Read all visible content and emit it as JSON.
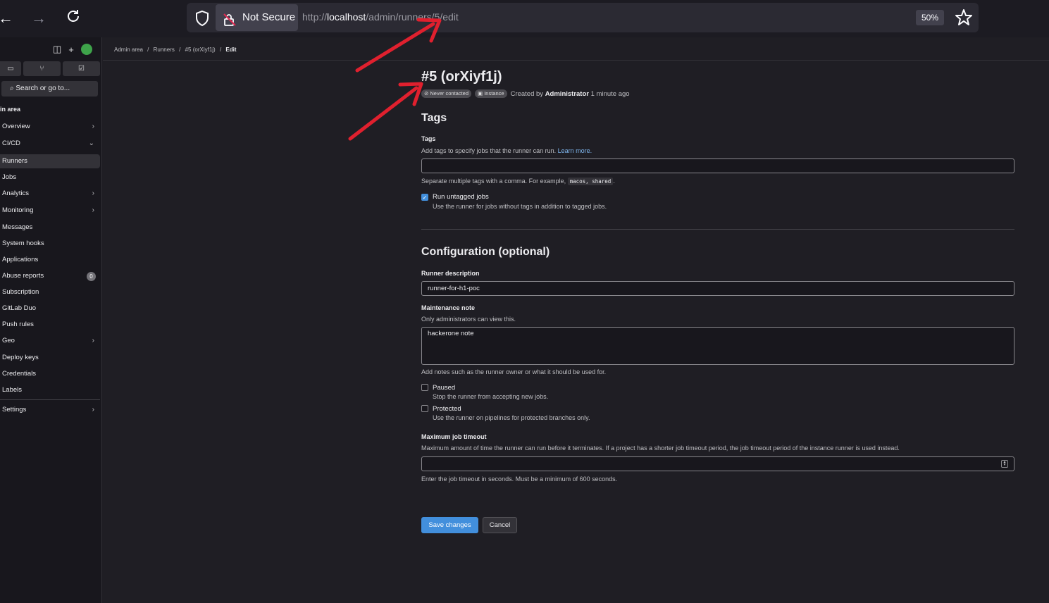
{
  "browser": {
    "security_label": "Not Secure",
    "url_prefix": "http://",
    "url_host": "localhost",
    "url_path": "/admin/runners/5/edit",
    "zoom": "50%"
  },
  "sidebar": {
    "search_placeholder": "Search or go to...",
    "section_title": "in area",
    "items": [
      {
        "label": "Overview",
        "chevron": "›"
      },
      {
        "label": "CI/CD",
        "chevron": "⌄"
      },
      {
        "label": "Runners"
      },
      {
        "label": "Jobs"
      },
      {
        "label": "Analytics",
        "chevron": "›"
      },
      {
        "label": "Monitoring",
        "chevron": "›"
      },
      {
        "label": "Messages"
      },
      {
        "label": "System hooks"
      },
      {
        "label": "Applications"
      },
      {
        "label": "Abuse reports",
        "badge": "0"
      },
      {
        "label": "Subscription"
      },
      {
        "label": "GitLab Duo"
      },
      {
        "label": "Push rules"
      },
      {
        "label": "Geo",
        "chevron": "›"
      },
      {
        "label": "Deploy keys"
      },
      {
        "label": "Credentials"
      },
      {
        "label": "Labels"
      },
      {
        "label": "Settings",
        "chevron": "›"
      }
    ]
  },
  "breadcrumb": {
    "items": [
      "Admin area",
      "Runners",
      "#5 (orXiyf1j)"
    ],
    "current": "Edit",
    "separator": "/"
  },
  "runner": {
    "title": "#5 (orXiyf1j)",
    "status_badge": "Never contacted",
    "type_badge": "Instance",
    "created_prefix": "Created by",
    "created_by": "Administrator",
    "created_when": "1 minute ago"
  },
  "tags_section": {
    "heading": "Tags",
    "label": "Tags",
    "help": "Add tags to specify jobs that the runner can run.",
    "learn_more": "Learn more.",
    "value": "",
    "separate_help_prefix": "Separate multiple tags with a comma. For example,",
    "separate_help_example": "macos, shared",
    "separate_help_suffix": ".",
    "run_untagged_label": "Run untagged jobs",
    "run_untagged_help": "Use the runner for jobs without tags in addition to tagged jobs.",
    "run_untagged_checked": true
  },
  "config_section": {
    "heading": "Configuration (optional)",
    "description_label": "Runner description",
    "description_value": "runner-for-h1-poc",
    "note_label": "Maintenance note",
    "note_help": "Only administrators can view this.",
    "note_value": "hackerone note",
    "note_footer": "Add notes such as the runner owner or what it should be used for.",
    "paused_label": "Paused",
    "paused_help": "Stop the runner from accepting new jobs.",
    "paused_checked": false,
    "protected_label": "Protected",
    "protected_help": "Use the runner on pipelines for protected branches only.",
    "protected_checked": false,
    "timeout_label": "Maximum job timeout",
    "timeout_help": "Maximum amount of time the runner can run before it terminates. If a project has a shorter job timeout period, the job timeout period of the instance runner is used instead.",
    "timeout_value": "",
    "timeout_footer": "Enter the job timeout in seconds. Must be a minimum of 600 seconds."
  },
  "actions": {
    "save_label": "Save changes",
    "cancel_label": "Cancel"
  },
  "colors": {
    "accent": "#428fdc",
    "annotation_arrow": "#e0202e"
  }
}
